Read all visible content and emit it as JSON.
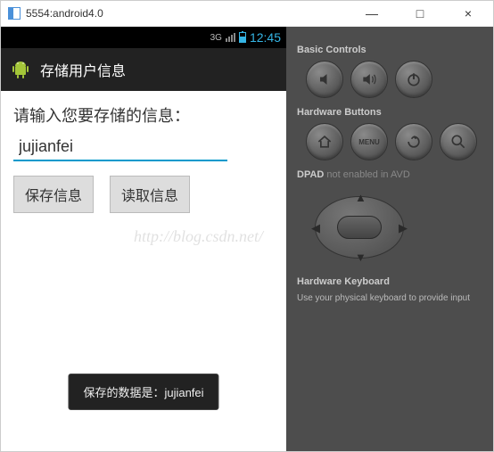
{
  "window": {
    "title": "5554:android4.0",
    "minimize": "—",
    "maximize": "□",
    "close": "×"
  },
  "statusbar": {
    "network": "3G",
    "time": "12:45"
  },
  "actionbar": {
    "title": "存储用户信息"
  },
  "screen": {
    "prompt": "请输入您要存储的信息：",
    "input_value": "jujianfei",
    "save_btn": "保存信息",
    "read_btn": "读取信息"
  },
  "toast": {
    "text": "保存的数据是：jujianfei"
  },
  "watermark": "http://blog.csdn.net/",
  "sidepanel": {
    "basic_label": "Basic Controls",
    "hardware_label": "Hardware Buttons",
    "menu_text": "MENU",
    "dpad_label": "DPAD",
    "dpad_note": "not enabled in AVD",
    "keyboard_label": "Hardware Keyboard",
    "keyboard_note": "Use your physical keyboard to provide input"
  }
}
